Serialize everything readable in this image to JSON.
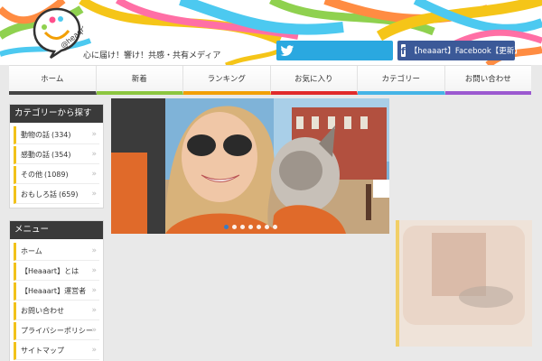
{
  "header": {
    "tagline": "心に届け！響け！共感・共有メディア",
    "logo_text": "@heaqrt",
    "twitter_label": "",
    "facebook_label": "【heaaart】Facebook【更新】"
  },
  "nav": {
    "items": [
      "ホーム",
      "新着",
      "ランキング",
      "お気に入り",
      "カテゴリー",
      "お問い合わせ"
    ],
    "colors": [
      "#444444",
      "#8cc63f",
      "#f29f05",
      "#e02a2a",
      "#45b4e6",
      "#9b59d0"
    ]
  },
  "sidebar": {
    "categories_title": "カテゴリーから探す",
    "categories": [
      {
        "label": "動物の話",
        "count": "(334)"
      },
      {
        "label": "感動の話",
        "count": "(354)"
      },
      {
        "label": "その他",
        "count": "(1089)"
      },
      {
        "label": "おもしろ話",
        "count": "(659)"
      }
    ],
    "menu_title": "メニュー",
    "menu": [
      "ホーム",
      "【Heaaart】とは",
      "【Heaaart】運営者",
      "お問い合わせ",
      "プライバシーポリシー",
      "サイトマップ"
    ]
  },
  "slider": {
    "dot_count": 7,
    "active_index": 0
  },
  "colors": {
    "twitter": "#2aa8e0",
    "facebook": "#3b5998",
    "category_accent": "#f2c21a"
  }
}
